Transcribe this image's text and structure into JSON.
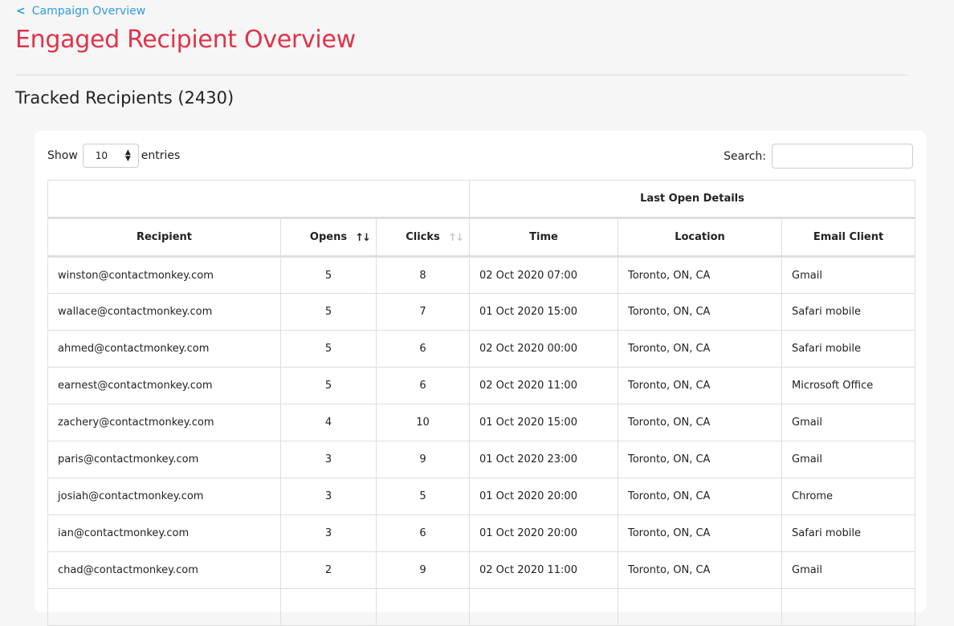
{
  "nav": {
    "back_label": "Campaign Overview"
  },
  "page": {
    "title": "Engaged Recipient Overview",
    "section_title": "Tracked Recipients (2430)"
  },
  "controls": {
    "show_label": "Show",
    "entries_value": "10",
    "entries_label": "entries",
    "search_label": "Search:",
    "search_value": ""
  },
  "table": {
    "group_header": "Last Open Details",
    "columns": [
      "Recipient",
      "Opens",
      "Clicks",
      "Time",
      "Location",
      "Email Client"
    ],
    "rows": [
      [
        "winston@contactmonkey.com",
        "5",
        "8",
        "02 Oct 2020 07:00",
        "Toronto, ON, CA",
        "Gmail"
      ],
      [
        "wallace@contactmonkey.com",
        "5",
        "7",
        "01 Oct 2020 15:00",
        "Toronto, ON, CA",
        "Safari mobile"
      ],
      [
        "ahmed@contactmonkey.com",
        "5",
        "6",
        "02 Oct 2020 00:00",
        "Toronto, ON, CA",
        "Safari mobile"
      ],
      [
        "earnest@contactmonkey.com",
        "5",
        "6",
        "02 Oct 2020 11:00",
        "Toronto, ON, CA",
        "Microsoft Office"
      ],
      [
        "zachery@contactmonkey.com",
        "4",
        "10",
        "01 Oct 2020 15:00",
        "Toronto, ON, CA",
        "Gmail"
      ],
      [
        "paris@contactmonkey.com",
        "3",
        "9",
        "01 Oct 2020 23:00",
        "Toronto, ON, CA",
        "Gmail"
      ],
      [
        "josiah@contactmonkey.com",
        "3",
        "5",
        "01 Oct 2020 20:00",
        "Toronto, ON, CA",
        "Chrome"
      ],
      [
        "ian@contactmonkey.com",
        "3",
        "6",
        "01 Oct 2020 20:00",
        "Toronto, ON, CA",
        "Safari mobile"
      ],
      [
        "chad@contactmonkey.com",
        "2",
        "9",
        "02 Oct 2020 11:00",
        "Toronto, ON, CA",
        "Gmail"
      ],
      [
        "",
        "",
        "",
        "",
        "",
        ""
      ]
    ]
  },
  "colors": {
    "accent": "#e0334a",
    "link": "#2f9be0"
  }
}
